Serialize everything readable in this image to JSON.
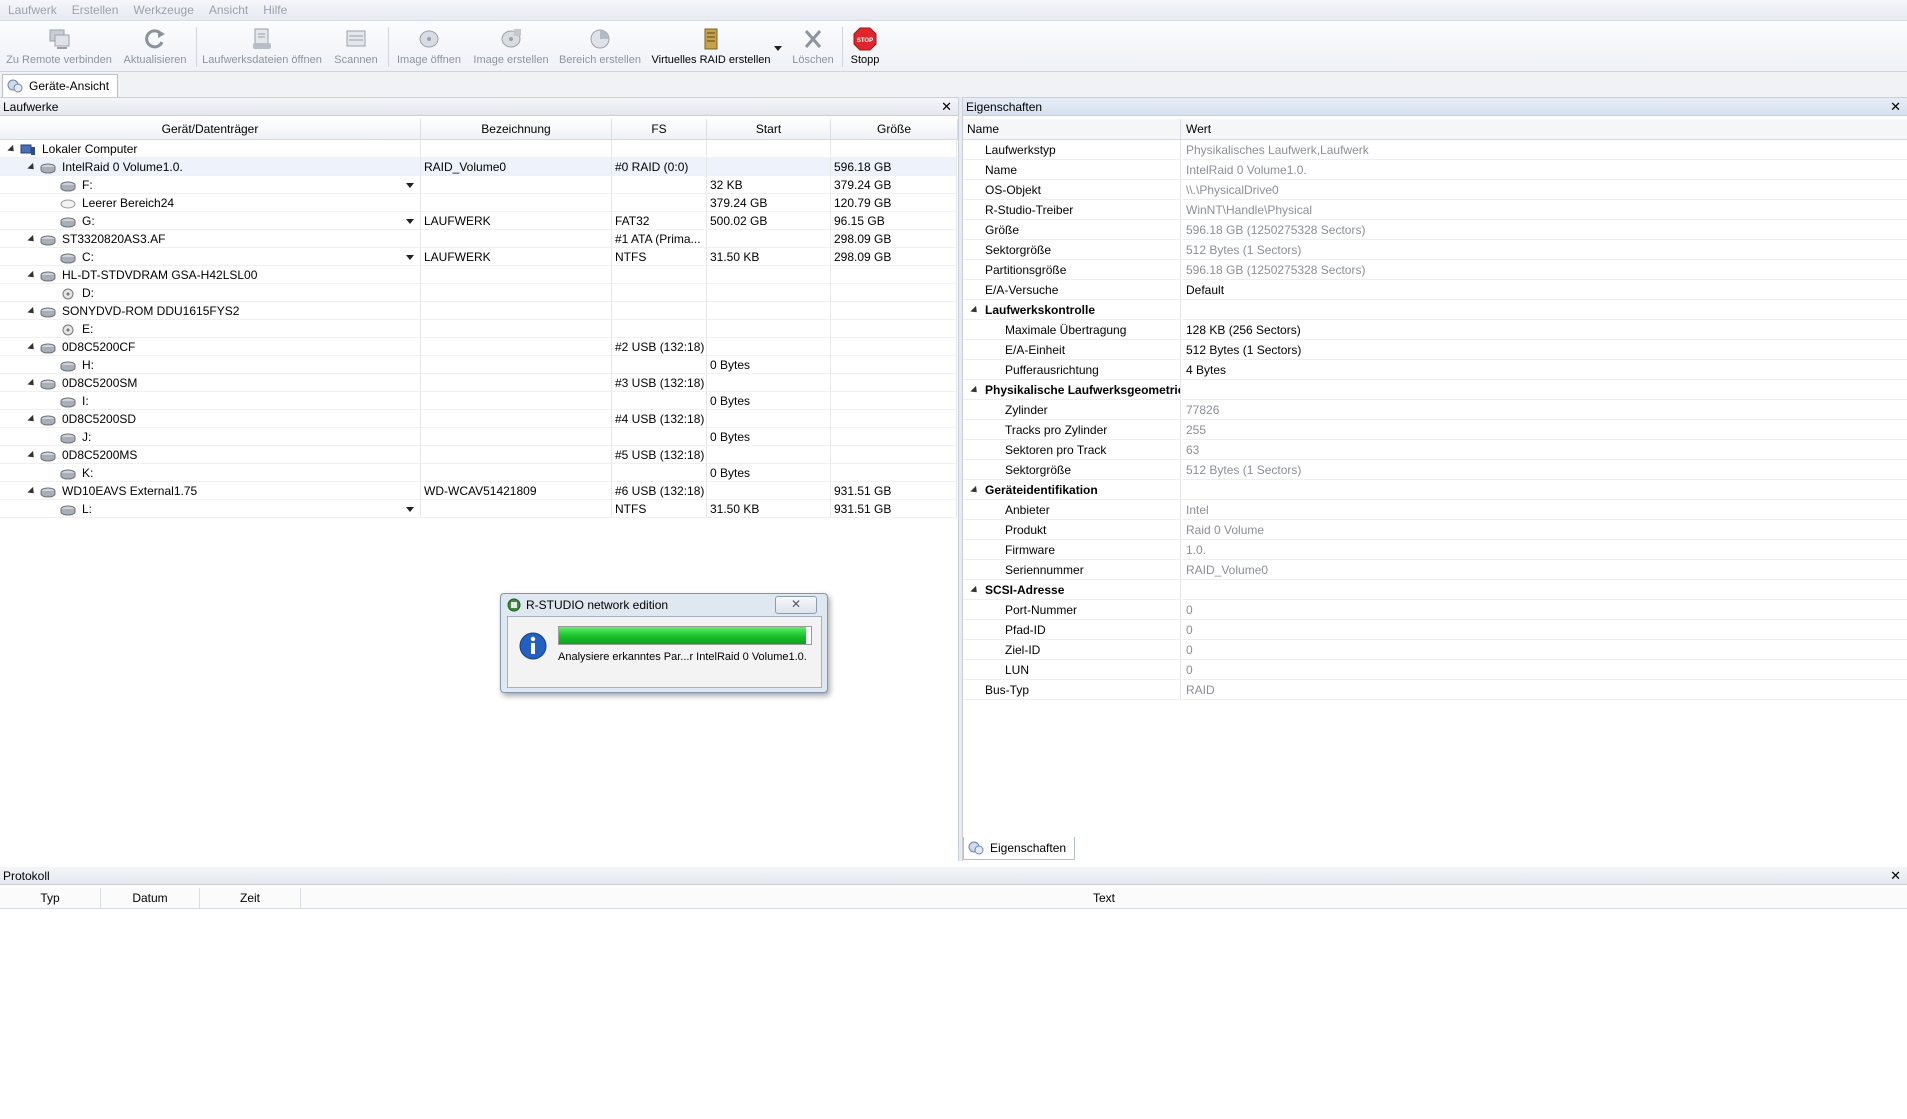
{
  "menu": [
    "Laufwerk",
    "Erstellen",
    "Werkzeuge",
    "Ansicht",
    "Hilfe"
  ],
  "toolbar": {
    "connect": "Zu Remote verbinden",
    "refresh": "Aktualisieren",
    "open_drive_files": "Laufwerksdateien öffnen",
    "scan": "Scannen",
    "open_image": "Image öffnen",
    "create_image": "Image erstellen",
    "create_region": "Bereich erstellen",
    "virtual_raid": "Virtuelles RAID erstellen",
    "delete": "Löschen",
    "stop": "Stopp",
    "stop_icon_text": "STOP"
  },
  "tab": {
    "label": "Geräte-Ansicht"
  },
  "drives_panel": {
    "title": "Laufwerke",
    "close": "✕",
    "columns": [
      "Gerät/Datenträger",
      "Bezeichnung",
      "FS",
      "Start",
      "Größe"
    ],
    "rows": [
      {
        "name": "Lokaler Computer",
        "label": "",
        "fs": "",
        "start": "",
        "size": ""
      },
      {
        "name": "IntelRaid 0 Volume1.0.",
        "label": "RAID_Volume0",
        "fs": "#0 RAID (0:0)",
        "start": "",
        "size": "596.18 GB"
      },
      {
        "name": "F:",
        "label": "",
        "fs": "",
        "start": "32 KB",
        "size": "379.24 GB"
      },
      {
        "name": "Leerer Bereich24",
        "label": "",
        "fs": "",
        "start": "379.24 GB",
        "size": "120.79 GB"
      },
      {
        "name": "G:",
        "label": "LAUFWERK",
        "fs": "FAT32",
        "start": "500.02 GB",
        "size": "96.15 GB"
      },
      {
        "name": "ST3320820AS3.AF",
        "label": "",
        "fs": "#1 ATA (Prima...",
        "start": "",
        "size": "298.09 GB"
      },
      {
        "name": "C:",
        "label": "LAUFWERK",
        "fs": "NTFS",
        "start": "31.50 KB",
        "size": "298.09 GB"
      },
      {
        "name": "HL-DT-STDVDRAM GSA-H42LSL00",
        "label": "",
        "fs": "",
        "start": "",
        "size": ""
      },
      {
        "name": "D:",
        "label": "",
        "fs": "",
        "start": "",
        "size": ""
      },
      {
        "name": "SONYDVD-ROM DDU1615FYS2",
        "label": "",
        "fs": "",
        "start": "",
        "size": ""
      },
      {
        "name": "E:",
        "label": "",
        "fs": "",
        "start": "",
        "size": ""
      },
      {
        "name": "0D8C5200CF",
        "label": "",
        "fs": "#2 USB (132:18)",
        "start": "",
        "size": ""
      },
      {
        "name": "H:",
        "label": "",
        "fs": "",
        "start": "0 Bytes",
        "size": ""
      },
      {
        "name": "0D8C5200SM",
        "label": "",
        "fs": "#3 USB (132:18)",
        "start": "",
        "size": ""
      },
      {
        "name": "I:",
        "label": "",
        "fs": "",
        "start": "0 Bytes",
        "size": ""
      },
      {
        "name": "0D8C5200SD",
        "label": "",
        "fs": "#4 USB (132:18)",
        "start": "",
        "size": ""
      },
      {
        "name": "J:",
        "label": "",
        "fs": "",
        "start": "0 Bytes",
        "size": ""
      },
      {
        "name": "0D8C5200MS",
        "label": "",
        "fs": "#5 USB (132:18)",
        "start": "",
        "size": ""
      },
      {
        "name": "K:",
        "label": "",
        "fs": "",
        "start": "0 Bytes",
        "size": ""
      },
      {
        "name": "WD10EAVS External1.75",
        "label": "WD-WCAV51421809",
        "fs": "#6 USB (132:18)",
        "start": "",
        "size": "931.51 GB"
      },
      {
        "name": "L:",
        "label": "",
        "fs": "NTFS",
        "start": "31.50 KB",
        "size": "931.51 GB"
      }
    ]
  },
  "props_panel": {
    "title": "Eigenschaften",
    "close": "✕",
    "columns": [
      "Name",
      "Wert"
    ],
    "rows": [
      {
        "name": "Laufwerkstyp",
        "value": "Physikalisches Laufwerk,Laufwerk"
      },
      {
        "name": "Name",
        "value": "IntelRaid 0 Volume1.0."
      },
      {
        "name": "OS-Objekt",
        "value": "\\\\.\\PhysicalDrive0"
      },
      {
        "name": "R-Studio-Treiber",
        "value": "WinNT\\Handle\\Physical"
      },
      {
        "name": "Größe",
        "value": "596.18 GB (1250275328 Sectors)"
      },
      {
        "name": "Sektorgröße",
        "value": "512 Bytes (1 Sectors)"
      },
      {
        "name": "Partitionsgröße",
        "value": "596.18 GB (1250275328 Sectors)"
      },
      {
        "name": "E/A-Versuche",
        "value": "Default"
      },
      {
        "name": "Laufwerkskontrolle",
        "value": ""
      },
      {
        "name": "Maximale Übertragung",
        "value": "128 KB (256 Sectors)"
      },
      {
        "name": "E/A-Einheit",
        "value": "512 Bytes (1 Sectors)"
      },
      {
        "name": "Pufferausrichtung",
        "value": "4 Bytes"
      },
      {
        "name": "Physikalische Laufwerksgeometrie",
        "value": ""
      },
      {
        "name": "Zylinder",
        "value": "77826"
      },
      {
        "name": "Tracks pro Zylinder",
        "value": "255"
      },
      {
        "name": "Sektoren pro Track",
        "value": "63"
      },
      {
        "name": "Sektorgröße",
        "value": "512 Bytes (1 Sectors)"
      },
      {
        "name": "Geräteidentifikation",
        "value": ""
      },
      {
        "name": "Anbieter",
        "value": "Intel"
      },
      {
        "name": "Produkt",
        "value": "Raid 0 Volume"
      },
      {
        "name": "Firmware",
        "value": "1.0."
      },
      {
        "name": "Seriennummer",
        "value": "RAID_Volume0"
      },
      {
        "name": "SCSI-Adresse",
        "value": ""
      },
      {
        "name": "Port-Nummer",
        "value": "0"
      },
      {
        "name": "Pfad-ID",
        "value": "0"
      },
      {
        "name": "Ziel-ID",
        "value": "0"
      },
      {
        "name": "LUN",
        "value": "0"
      },
      {
        "name": "Bus-Typ",
        "value": "RAID"
      }
    ],
    "bottom_tab": "Eigenschaften"
  },
  "log_panel": {
    "title": "Protokoll",
    "close": "✕",
    "columns": [
      "Typ",
      "Datum",
      "Zeit",
      "Text"
    ]
  },
  "dialog": {
    "title": "R-STUDIO network edition",
    "close": "✕",
    "message": "Analysiere erkanntes Par...r IntelRaid 0 Volume1.0.",
    "progress": 0.98
  }
}
